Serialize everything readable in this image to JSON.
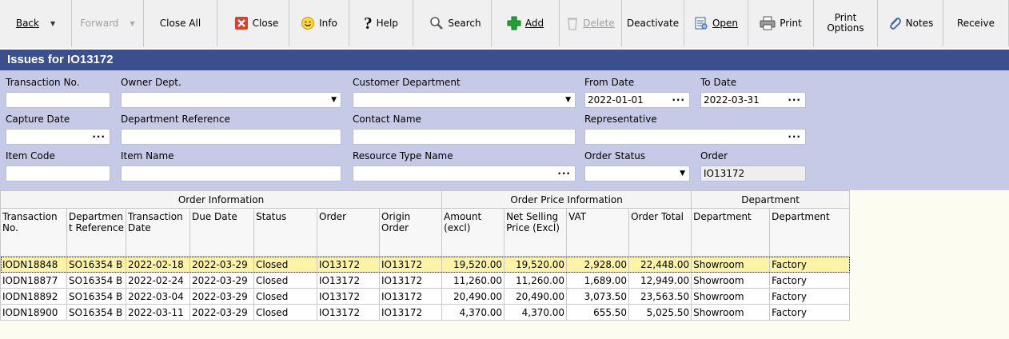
{
  "toolbar": {
    "back": "Back",
    "forward": "Forward",
    "close_all": "Close All",
    "close": "Close",
    "info": "Info",
    "help": "Help",
    "search": "Search",
    "add": "Add",
    "delete": "Delete",
    "deactivate": "Deactivate",
    "open": "Open",
    "print": "Print",
    "print_options_line1": "Print",
    "print_options_line2": "Options",
    "notes": "Notes",
    "receive": "Receive"
  },
  "title": "Issues for IO13172",
  "filters": {
    "transaction_no": {
      "label": "Transaction No.",
      "value": ""
    },
    "owner_dept": {
      "label": "Owner Dept.",
      "value": ""
    },
    "customer_department": {
      "label": "Customer Department",
      "value": ""
    },
    "from_date": {
      "label": "From Date",
      "value": "2022-01-01"
    },
    "to_date": {
      "label": "To Date",
      "value": "2022-03-31"
    },
    "capture_date": {
      "label": "Capture Date",
      "value": ""
    },
    "department_reference": {
      "label": "Department Reference",
      "value": ""
    },
    "contact_name": {
      "label": "Contact Name",
      "value": ""
    },
    "representative": {
      "label": "Representative",
      "value": ""
    },
    "item_code": {
      "label": "Item Code",
      "value": ""
    },
    "item_name": {
      "label": "Item Name",
      "value": ""
    },
    "resource_type_name": {
      "label": "Resource Type Name",
      "value": ""
    },
    "order_status": {
      "label": "Order Status",
      "value": ""
    },
    "order": {
      "label": "Order",
      "value": "IO13172"
    }
  },
  "grid": {
    "groups": [
      "Order Information",
      "Order Price Information",
      "Department"
    ],
    "columns": {
      "transaction_no": "Transaction No.",
      "department_reference": "Department Reference",
      "transaction_date": "Transaction Date",
      "due_date": "Due Date",
      "status": "Status",
      "order": "Order",
      "origin_order": "Origin Order",
      "amount_excl": "Amount (excl)",
      "net_selling": "Net Selling Price (Excl)",
      "vat": "VAT",
      "order_total": "Order Total",
      "department": "Department",
      "department2": "Department"
    },
    "rows": [
      {
        "tx": "IODN18848",
        "ref": "SO16354 B",
        "date": "2022-02-18",
        "due": "2022-03-29",
        "status": "Closed",
        "order": "IO13172",
        "origin": "IO13172",
        "amount": "19,520.00",
        "net": "19,520.00",
        "vat": "2,928.00",
        "total": "22,448.00",
        "dept": "Showroom",
        "dept2": "Factory"
      },
      {
        "tx": "IODN18877",
        "ref": "SO16354 B",
        "date": "2022-02-24",
        "due": "2022-03-29",
        "status": "Closed",
        "order": "IO13172",
        "origin": "IO13172",
        "amount": "11,260.00",
        "net": "11,260.00",
        "vat": "1,689.00",
        "total": "12,949.00",
        "dept": "Showroom",
        "dept2": "Factory"
      },
      {
        "tx": "IODN18892",
        "ref": "SO16354 B",
        "date": "2022-03-04",
        "due": "2022-03-29",
        "status": "Closed",
        "order": "IO13172",
        "origin": "IO13172",
        "amount": "20,490.00",
        "net": "20,490.00",
        "vat": "3,073.50",
        "total": "23,563.50",
        "dept": "Showroom",
        "dept2": "Factory"
      },
      {
        "tx": "IODN18900",
        "ref": "SO16354 B",
        "date": "2022-03-11",
        "due": "2022-03-29",
        "status": "Closed",
        "order": "IO13172",
        "origin": "IO13172",
        "amount": "4,370.00",
        "net": "4,370.00",
        "vat": "655.50",
        "total": "5,025.50",
        "dept": "Showroom",
        "dept2": "Factory"
      }
    ]
  },
  "colors": {
    "title_bar": "#3b4f8c",
    "filter_bg": "#c6cae6",
    "selected_row": "#fff3a6",
    "close_icon": "#d9402b",
    "add_icon": "#21a232"
  }
}
